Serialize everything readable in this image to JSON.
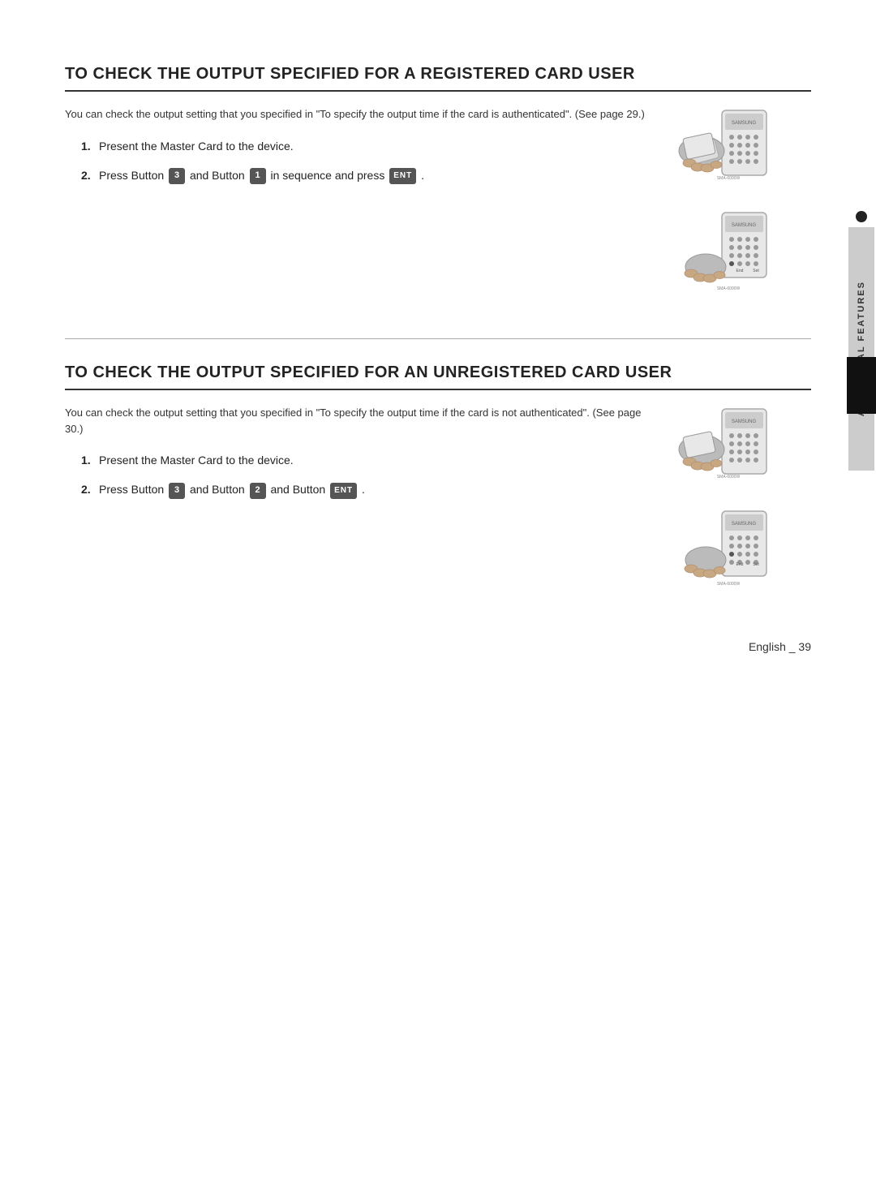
{
  "page": {
    "title": "Additional Features",
    "footer": "English _ 39"
  },
  "section1": {
    "title": "To Check the Output Specified for a Registered Card User",
    "description": "You can check the output setting that you specified in \"To specify the output time if the card is authenticated\". (See page 29.)",
    "steps": [
      {
        "num": "1.",
        "text": "Present the Master Card to the device."
      },
      {
        "num": "2.",
        "text_prefix": "Press Button",
        "btn1": "3",
        "text_mid1": "and Button",
        "btn2": "1",
        "text_mid2": "in sequence and press",
        "btn3": "ENT",
        "text_suffix": "."
      }
    ]
  },
  "section2": {
    "title": "To Check the Output Specified for an Unregistered Card User",
    "description": "You can check the output setting that you specified in \"To specify the output time if the card is not authenticated\". (See page 30.)",
    "steps": [
      {
        "num": "1.",
        "text": "Present the Master Card to the device."
      },
      {
        "num": "2.",
        "text_prefix": "Press Button",
        "btn1": "3",
        "text_mid1": "and Button",
        "btn2": "2",
        "text_mid2": "and Button",
        "btn3": "ENT",
        "text_suffix": "."
      }
    ]
  },
  "sidebar": {
    "label": "Additional Features"
  }
}
